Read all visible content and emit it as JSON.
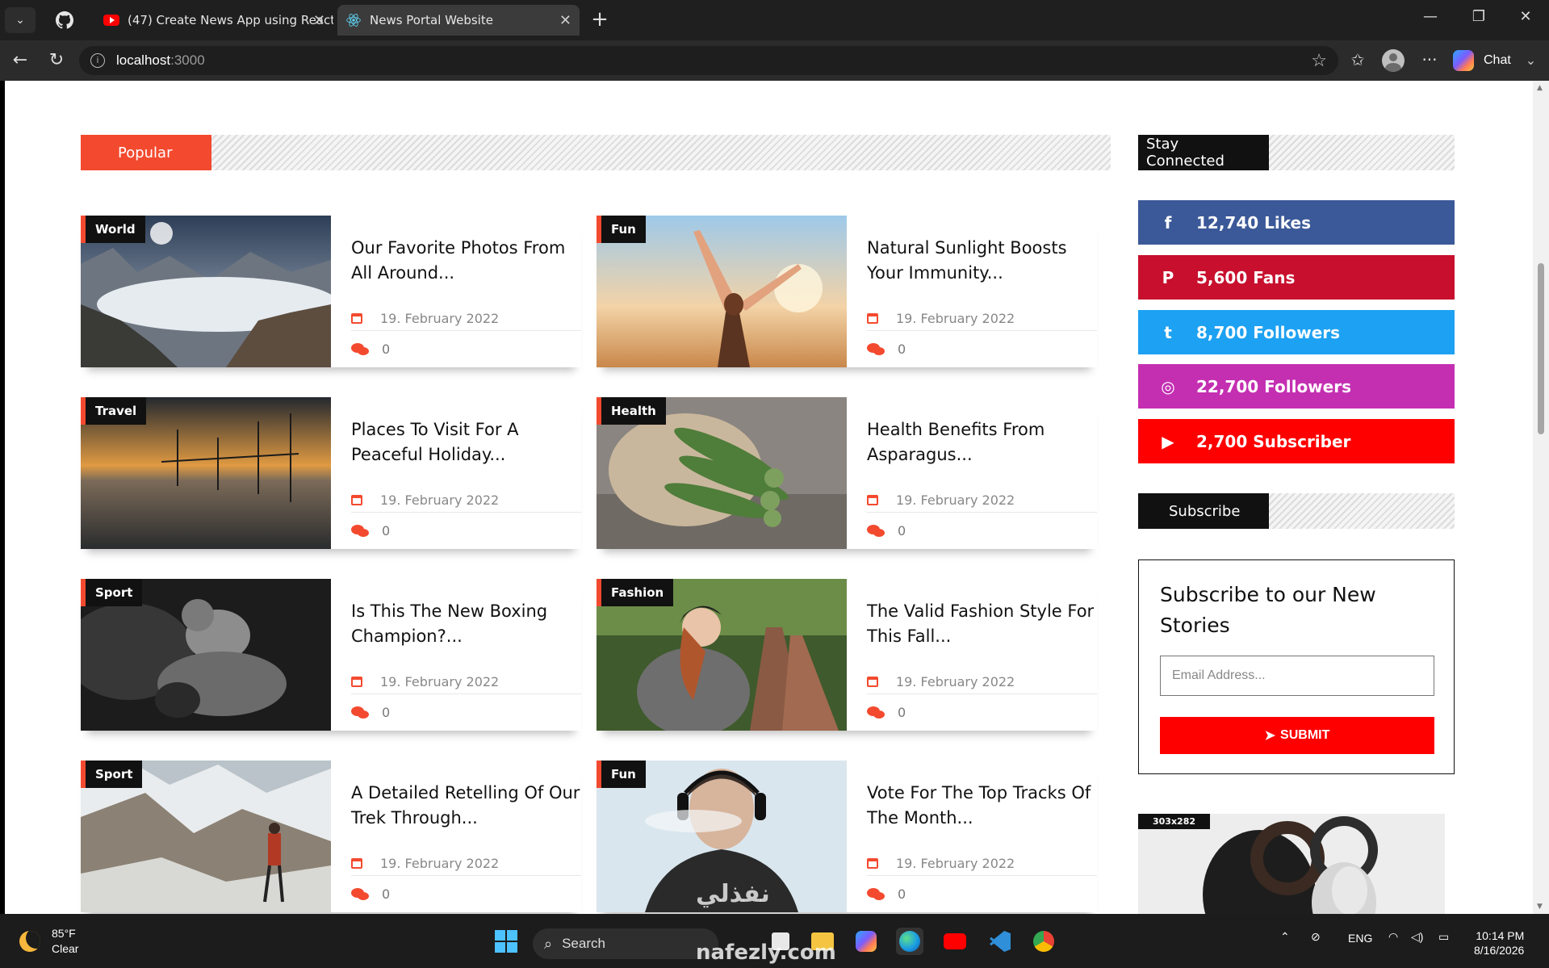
{
  "browser": {
    "tabs": [
      {
        "label": "(47) Create News App using React"
      },
      {
        "label": "News Portal Website"
      }
    ],
    "url_host": "localhost",
    "url_port": ":3000",
    "chat_label": "Chat"
  },
  "page": {
    "popular_label": "Popular",
    "stay_connected_label": "Stay Connected",
    "subscribe_label": "Subscribe",
    "posts": [
      {
        "category": "World",
        "title": "Our Favorite Photos From All Around...",
        "date": "19. February 2022",
        "comments": "0"
      },
      {
        "category": "Fun",
        "title": "Natural Sunlight Boosts Your Immunity...",
        "date": "19. February 2022",
        "comments": "0"
      },
      {
        "category": "Travel",
        "title": "Places To Visit For A Peaceful Holiday...",
        "date": "19. February 2022",
        "comments": "0"
      },
      {
        "category": "Health",
        "title": "Health Benefits From Asparagus...",
        "date": "19. February 2022",
        "comments": "0"
      },
      {
        "category": "Sport",
        "title": "Is This The New Boxing Champion?...",
        "date": "19. February 2022",
        "comments": "0"
      },
      {
        "category": "Fashion",
        "title": "The Valid Fashion Style For This Fall...",
        "date": "19. February 2022",
        "comments": "0"
      },
      {
        "category": "Sport",
        "title": "A Detailed Retelling Of Our Trek Through...",
        "date": "19. February 2022",
        "comments": "0"
      },
      {
        "category": "Fun",
        "title": "Vote For The Top Tracks Of The Month...",
        "date": "19. February 2022",
        "comments": "0"
      }
    ],
    "social": [
      {
        "label": "12,740 Likes",
        "icon": "facebook-icon",
        "glyph": "f",
        "color": "#3b5998"
      },
      {
        "label": "5,600 Fans",
        "icon": "pinterest-icon",
        "glyph": "P",
        "color": "#c8102e"
      },
      {
        "label": "8,700 Followers",
        "icon": "twitter-icon",
        "glyph": "t",
        "color": "#1da1f2"
      },
      {
        "label": "22,700 Followers",
        "icon": "instagram-icon",
        "glyph": "◎",
        "color": "#c42fb2"
      },
      {
        "label": "2,700 Subscriber",
        "icon": "youtube-icon",
        "glyph": "▶",
        "color": "#ff0000"
      }
    ],
    "subscribe_box": {
      "title": "Subscribe to our New Stories",
      "email_placeholder": "Email Address...",
      "submit_label": "SUBMIT"
    },
    "ad_label": "303x282",
    "accent_color": "#f34a2f"
  },
  "taskbar": {
    "temperature": "85°F",
    "condition": "Clear",
    "search_label": "Search",
    "language": "ENG",
    "time": "10:14 PM",
    "date": "8/16/2026"
  },
  "watermark": {
    "brand_ar": "نفذلي",
    "domain": "nafezly.com"
  }
}
